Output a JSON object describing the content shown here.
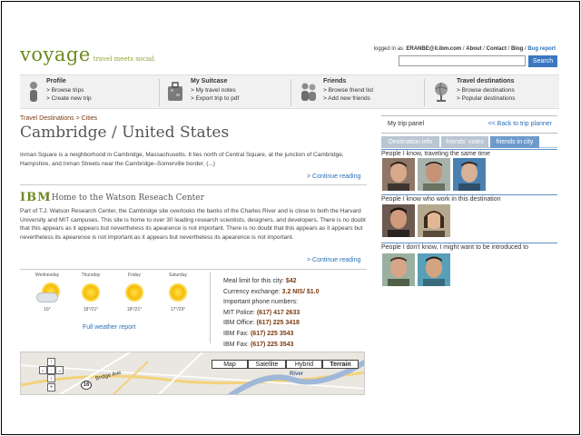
{
  "header": {
    "logo": "voyage",
    "tagline": "travel meets social.",
    "logged_in_prefix": "logged in as:",
    "user": "ERANBE@il.ibm.com",
    "links": [
      "About",
      "Contact",
      "Blog"
    ],
    "bug_report": "Bug report",
    "search_value": "",
    "search_label": "Search"
  },
  "nav": [
    {
      "title": "Profile",
      "links": [
        "> Browse trips",
        "> Create new trip"
      ],
      "icon": "person-icon"
    },
    {
      "title": "My Suitcase",
      "links": [
        "> My travel notes",
        "> Export trip to pdf"
      ],
      "icon": "suitcase-icon"
    },
    {
      "title": "Friends",
      "links": [
        "> Browse friend list",
        "> Add new friends"
      ],
      "icon": "friends-icon"
    },
    {
      "title": "Travel destinations",
      "links": [
        "> Browse destinations",
        "> Popular destinations"
      ],
      "icon": "globe-icon"
    }
  ],
  "main": {
    "breadcrumb": "Travel Destinations > Cities",
    "title": "Cambridge / United States",
    "intro": "Inman Square is a neighborhood in Cambridge, Massachusetts. It lies north of Central Square, at the junction of Cambridge, Hampshire, and Inman Streets near the Cambridge–Somerville border. (...)",
    "continue": "> Continue reading",
    "poi_logo": "IBM",
    "poi_title": "/ Home to the Watson Reseach Center",
    "poi_text": "Part of T.J. Watson Research Center, the Cambridge site overlooks the banks of the Charles River and is close to both the Harvard University and MIT campuses. This site is home to over 30 leading research scientists, designers, and developers. There is no doubt that this appears as it appears but nevertheless its apearence is not important. There is no doubt that this appears as it appears but nevertheless its apearence is not important.as it appears but nevertheless its apearence is not important.",
    "continue2": "> Continue reading"
  },
  "weather": {
    "days": [
      {
        "day": "Wednesday",
        "temp": "16°",
        "icon": "partly-cloudy-icon"
      },
      {
        "day": "Thursday",
        "temp": "18°/21°",
        "icon": "sun-icon"
      },
      {
        "day": "Friday",
        "temp": "18°/21°",
        "icon": "sun-icon"
      },
      {
        "day": "Saturday",
        "temp": "17°/29°",
        "icon": "sun-icon"
      }
    ],
    "full_link": "Full weather report"
  },
  "info": {
    "meal_label": "Meal limit for this city:",
    "meal_value": "$42",
    "currency_label": "Currency exchange:",
    "currency_value": "3.2 NIS/ $1.0",
    "phones_label": "Important phone numbers:",
    "phones": [
      {
        "label": "MIT Police:",
        "value": "(617) 417 2633"
      },
      {
        "label": "IBM Office:",
        "value": "(617) 225 3418"
      },
      {
        "label": "IBM Fax:",
        "value": "(617) 225 3543"
      },
      {
        "label": "IBM Fax:",
        "value": "(617) 225 3543"
      }
    ]
  },
  "map": {
    "types": [
      "Map",
      "Satellite",
      "Hybrid",
      "Terrain"
    ],
    "active": "Terrain",
    "labels": {
      "river": "River",
      "road": "Bridge Ave",
      "route": "16"
    }
  },
  "panel": {
    "title": "My trip panel",
    "back": "<< Back to trip planner",
    "tabs": [
      "Destination info",
      "friends' notes",
      "friends in city"
    ],
    "active_tab": "friends in city",
    "sections": [
      {
        "title": "People I know, traveling the same time"
      },
      {
        "title": "People I know who work in this destination"
      },
      {
        "title": "People I don't know, I might want to be introduced to"
      }
    ]
  },
  "colors": {
    "accent": "#6e8a1f",
    "link": "#2a6fb5",
    "brown": "#7a3a10",
    "tab_active": "#6d9acb"
  }
}
